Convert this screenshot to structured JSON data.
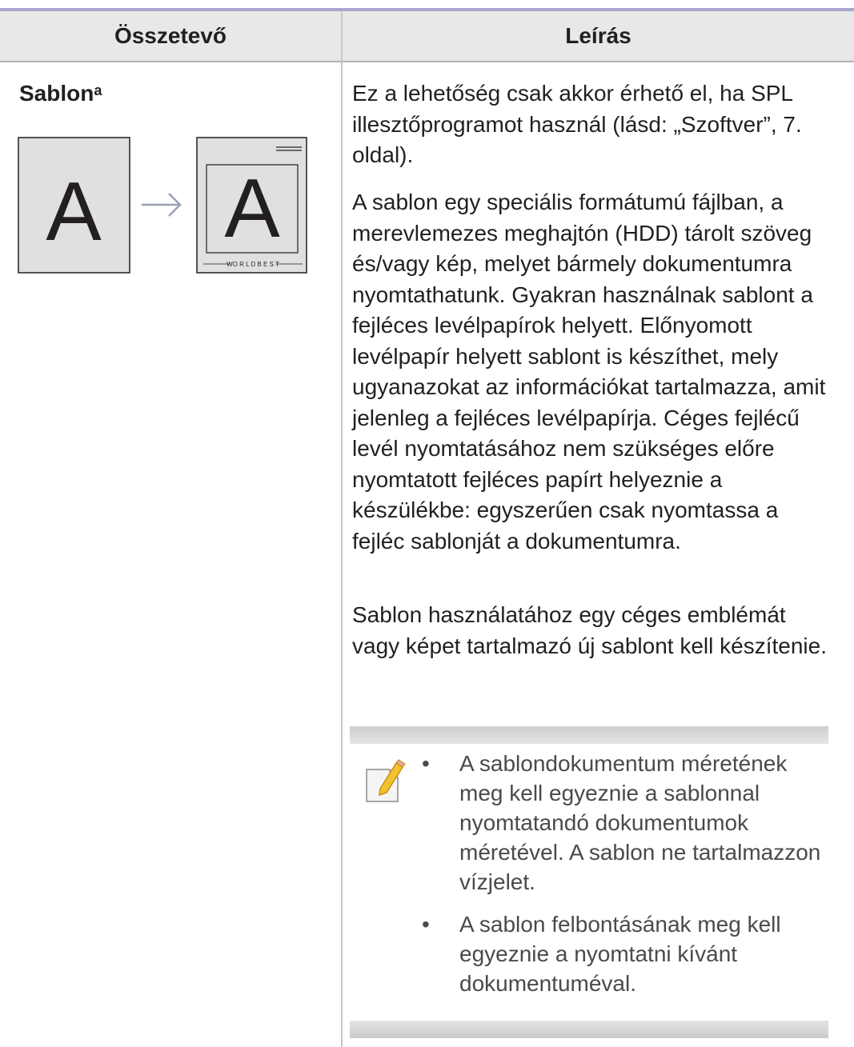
{
  "table": {
    "header": {
      "component": "Összetevő",
      "description": "Leírás"
    }
  },
  "row": {
    "component_title": "Sablon",
    "component_footnote": "a",
    "illustration": {
      "before_letter": "A",
      "after_letter": "A",
      "footer_text": "WO R L D  B E S T",
      "arrow_icon": "arrow-right-icon"
    },
    "paragraphs": [
      "Ez a lehetőség csak akkor érhető el, ha SPL illesztőprogramot használ (lásd: „Szoftver”, 7. oldal).",
      "A sablon egy speciális formátumú fájlban, a merevlemezes meghajtón (HDD) tárolt szöveg és/vagy kép, melyet bármely dokumentumra nyomtathatunk. Gyakran használnak sablont a fejléces levélpapírok helyett. Előnyomott levélpapír helyett sablont is készíthet, mely ugyanazokat az információkat tartalmazza, amit jelenleg a fejléces levélpapírja. Céges fejlécű levél nyomtatásához nem szükséges előre nyomtatott fejléces papírt helyeznie a készülékbe: egyszerűen csak nyomtassa a fejléc sablonját a dokumentumra.",
      "Sablon használatához egy céges emblémát vagy képet tartalmazó új sablont kell készítenie."
    ],
    "note": {
      "icon": "note-pencil-icon",
      "bullet": "•",
      "items": [
        "A sablondokumentum méretének meg kell egyeznie a sablonnal nyomtatandó dokumentumok méretével. A sablon ne tartalmazzon vízjelet.",
        "A sablon felbontásának meg kell egyeznie a nyomtatni kívánt dokumentuméval."
      ]
    }
  },
  "colors": {
    "top_rule": "#a9a7cf",
    "header_bg": "#e8e8e8",
    "text": "#231f20",
    "note_text": "#4a4a4a",
    "pencil": "#f2c230"
  }
}
